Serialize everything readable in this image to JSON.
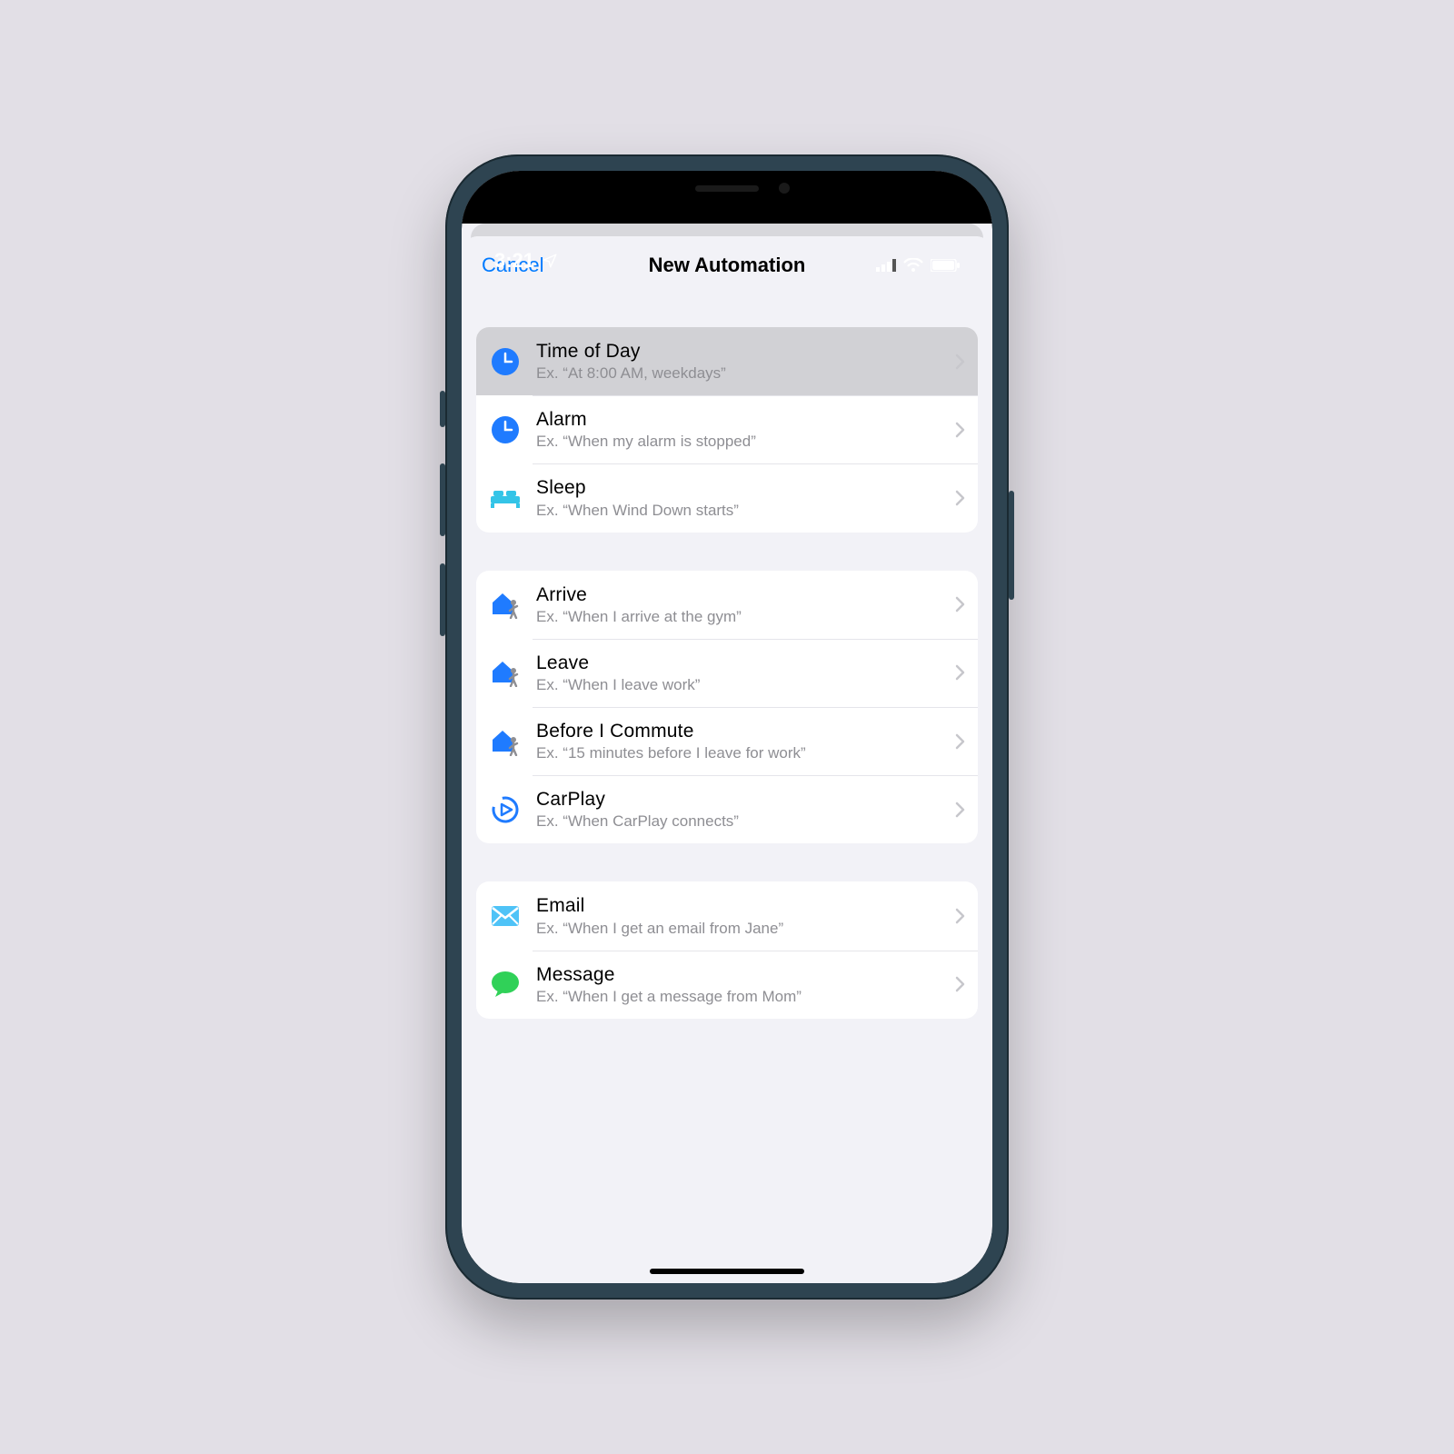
{
  "status": {
    "time": "3:21"
  },
  "nav": {
    "cancel": "Cancel",
    "title": "New Automation"
  },
  "groups": [
    {
      "rows": [
        {
          "icon": "clock-solid",
          "title": "Time of Day",
          "sub": "Ex. “At 8:00 AM, weekdays”",
          "selected": true
        },
        {
          "icon": "clock-solid",
          "title": "Alarm",
          "sub": "Ex. “When my alarm is stopped”"
        },
        {
          "icon": "bed",
          "title": "Sleep",
          "sub": "Ex. “When Wind Down starts”"
        }
      ]
    },
    {
      "rows": [
        {
          "icon": "house-person",
          "title": "Arrive",
          "sub": "Ex. “When I arrive at the gym”"
        },
        {
          "icon": "house-person",
          "title": "Leave",
          "sub": "Ex. “When I leave work”"
        },
        {
          "icon": "house-person",
          "title": "Before I Commute",
          "sub": "Ex. “15 minutes before I leave for work”"
        },
        {
          "icon": "carplay",
          "title": "CarPlay",
          "sub": "Ex. “When CarPlay connects”"
        }
      ]
    },
    {
      "rows": [
        {
          "icon": "mail",
          "title": "Email",
          "sub": "Ex. “When I get an email from Jane”"
        },
        {
          "icon": "message",
          "title": "Message",
          "sub": "Ex. “When I get a message from Mom”"
        }
      ]
    }
  ]
}
